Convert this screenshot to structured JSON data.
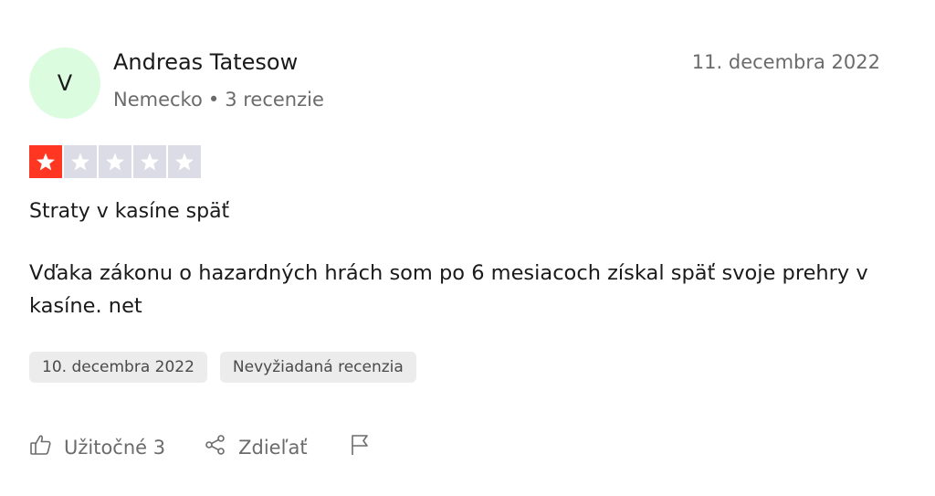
{
  "author": {
    "initial": "V",
    "name": "Andreas Tatesow",
    "country": "Nemecko",
    "separator": "•",
    "reviews_count": "3 recenzie"
  },
  "review": {
    "date": "11. decembra 2022",
    "rating": 1,
    "rating_max": 5,
    "title": "Straty v kasíne späť",
    "body": "Vďaka zákonu o hazardných hrách som po 6 mesiacoch získal späť svoje prehry v kasíne. net"
  },
  "tags": {
    "experience_date": "10. decembra 2022",
    "review_type": "Nevyžiadaná recenzia"
  },
  "actions": {
    "useful_label": "Užitočné 3",
    "share_label": "Zdieľať"
  },
  "colors": {
    "star_filled": "#ff3722",
    "star_empty": "#dcdce6",
    "avatar_bg": "#dcfce0",
    "tag_bg": "#ececec"
  },
  "icons": {
    "useful": "thumbs-up-icon",
    "share": "share-icon",
    "report": "flag-icon",
    "star": "star-icon"
  }
}
